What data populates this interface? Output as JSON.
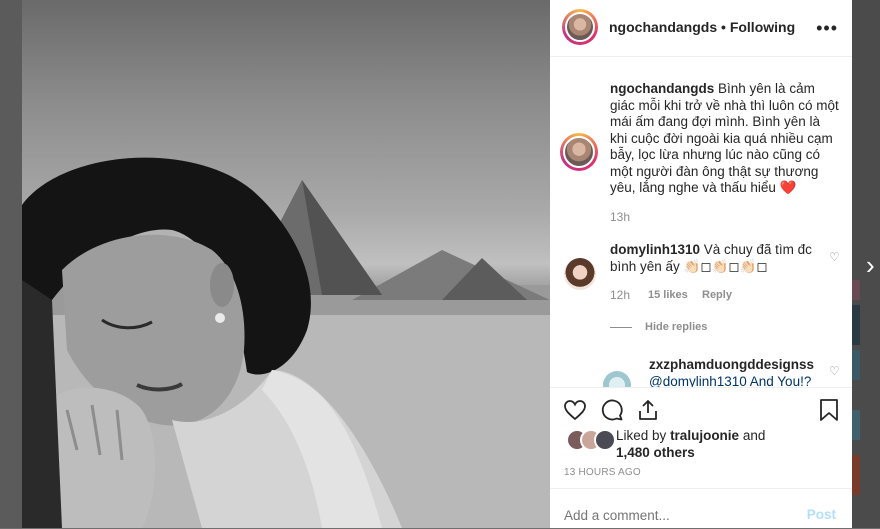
{
  "post": {
    "username": "ngochandangds",
    "separator": "•",
    "follow_status": "Following",
    "more_icon": "more-horizontal-icon"
  },
  "caption": {
    "username": "ngochandangds",
    "text": "Bình yên là cảm giác mỗi khi trở về nhà thì luôn có một mái ấm đang đợi mình. Bình yên là khi cuộc đời ngoài kia quá nhiều cạm bẫy, lọc lừa nhưng lúc nào cũng có một người đàn ông thật sự thương yêu, lắng nghe và thấu hiểu",
    "emoji": "❤️",
    "age": "13h"
  },
  "comments": [
    {
      "username": "domylinh1310",
      "text": "Và chuy đã tìm đc bình yên ấy 👏🏻◻👏🏻◻👏🏻◻",
      "age": "12h",
      "likes": "15 likes",
      "reply": "Reply",
      "hide_replies": "Hide replies"
    },
    {
      "username": "zxzphamduongddesignss",
      "text": "@domylinh1310 And You!?"
    }
  ],
  "likes": {
    "prefix": "Liked by",
    "user": "tralujoonie",
    "and": "and",
    "others": "1,480 others"
  },
  "timestamp": "13 HOURS AGO",
  "comment_box": {
    "placeholder": "Add a comment...",
    "post_label": "Post"
  },
  "nav": {
    "next_arrow": "›"
  },
  "colors": {
    "text": "#262626",
    "muted": "#8e8e8e",
    "link": "#003569",
    "post_disabled": "#b2dffc",
    "heart": "#ed4956"
  }
}
